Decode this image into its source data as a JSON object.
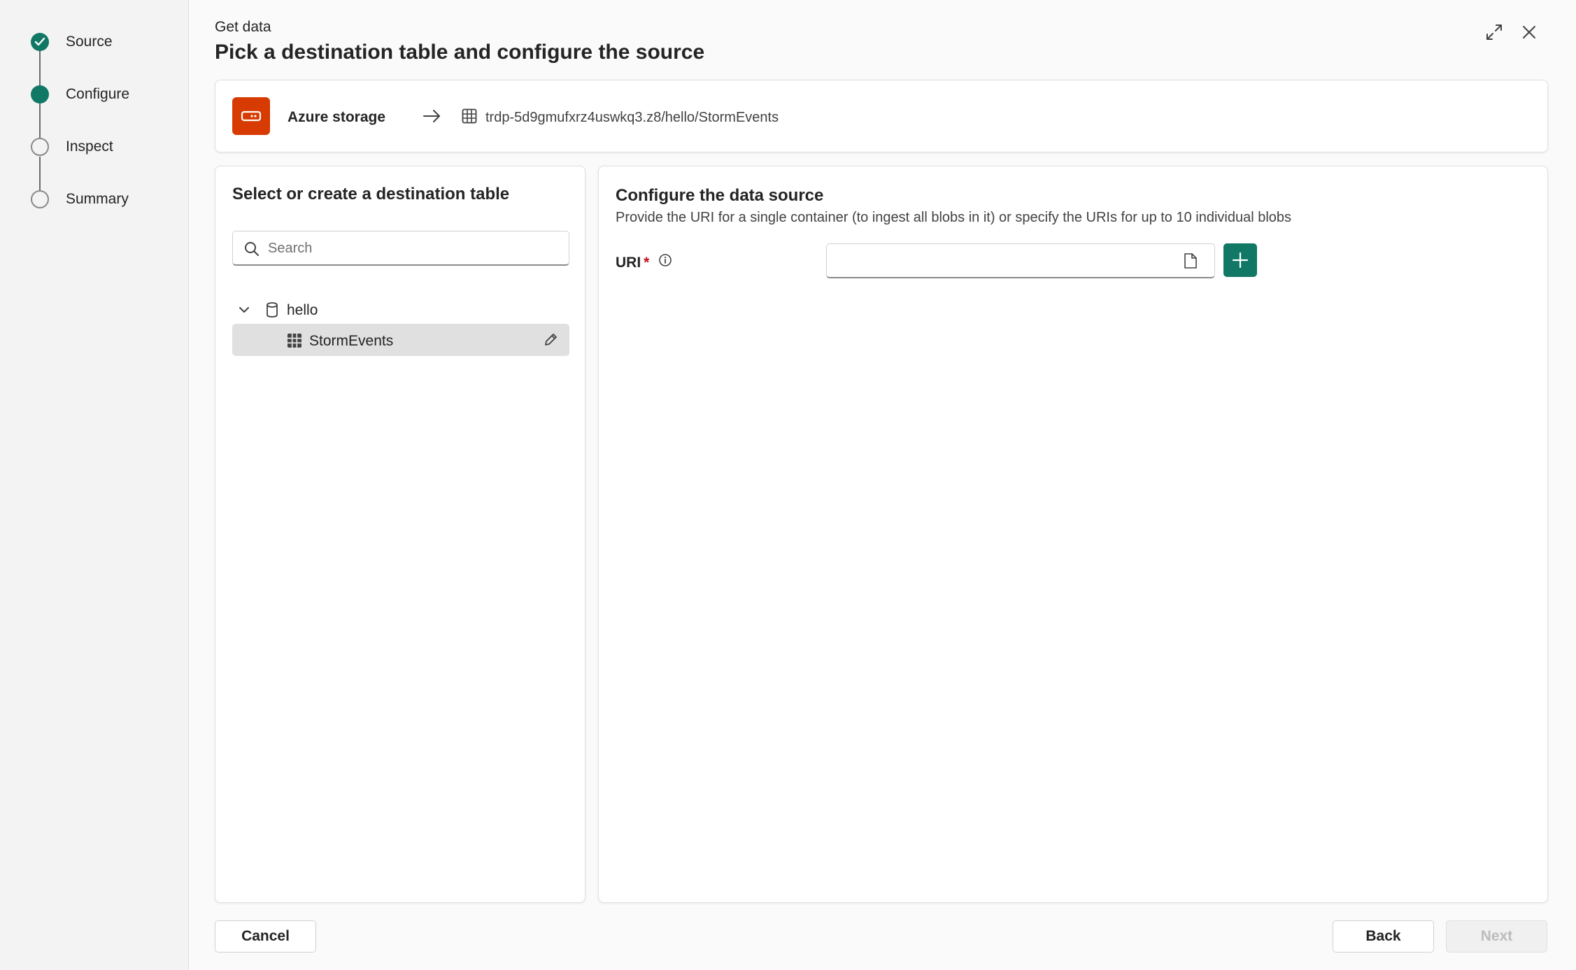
{
  "stepper": {
    "steps": [
      {
        "label": "Source",
        "state": "done"
      },
      {
        "label": "Configure",
        "state": "current"
      },
      {
        "label": "Inspect",
        "state": "pending"
      },
      {
        "label": "Summary",
        "state": "pending"
      }
    ]
  },
  "header": {
    "subtitle": "Get data",
    "title": "Pick a destination table and configure the source",
    "expand_icon": "expand-icon",
    "close_icon": "close-icon"
  },
  "source_bar": {
    "source_name": "Azure storage",
    "destination_path": "trdp-5d9gmufxrz4uswkq3.z8/hello/StormEvents",
    "badge_color": "#d83b01"
  },
  "destination_panel": {
    "title": "Select or create a destination table",
    "search_placeholder": "Search",
    "database_name": "hello",
    "table_name": "StormEvents"
  },
  "config_panel": {
    "title": "Configure the data source",
    "description": "Provide the URI for a single container (to ingest all blobs in it) or specify the URIs for up to 10 individual blobs",
    "uri_label": "URI",
    "required_marker": "*",
    "uri_value": ""
  },
  "footer": {
    "cancel_label": "Cancel",
    "back_label": "Back",
    "next_label": "Next"
  },
  "colors": {
    "accent": "#117865",
    "required": "#c50f1f",
    "azure_badge": "#d83b01"
  }
}
